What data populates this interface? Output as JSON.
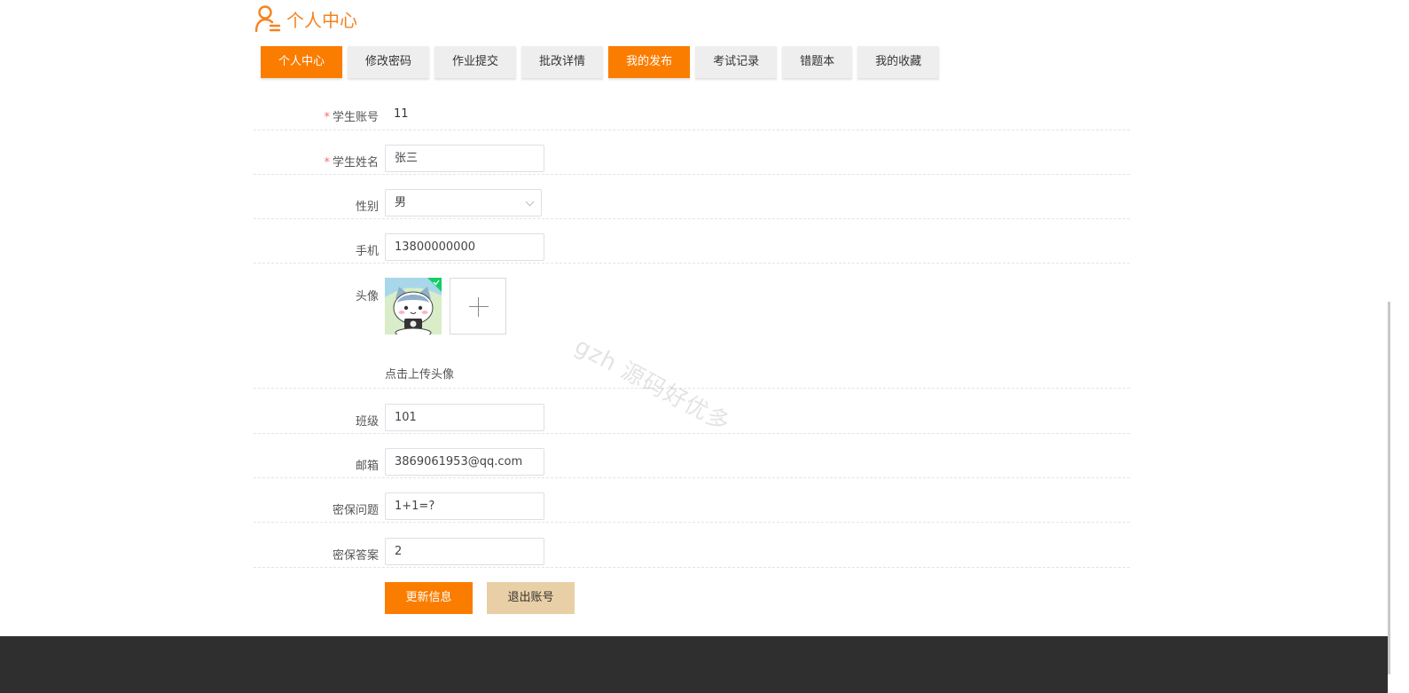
{
  "header": {
    "title": "个人中心"
  },
  "tabs": [
    {
      "label": "个人中心",
      "active": true
    },
    {
      "label": "修改密码",
      "active": false
    },
    {
      "label": "作业提交",
      "active": false
    },
    {
      "label": "批改详情",
      "active": false
    },
    {
      "label": "我的发布",
      "active": true
    },
    {
      "label": "考试记录",
      "active": false
    },
    {
      "label": "错题本",
      "active": false
    },
    {
      "label": "我的收藏",
      "active": false
    }
  ],
  "form": {
    "account": {
      "label": "学生账号",
      "value": "11",
      "required": true
    },
    "name": {
      "label": "学生姓名",
      "value": "张三",
      "required": true
    },
    "gender": {
      "label": "性别",
      "value": "男"
    },
    "phone": {
      "label": "手机",
      "value": "13800000000"
    },
    "avatar": {
      "label": "头像",
      "hint": "点击上传头像"
    },
    "class": {
      "label": "班级",
      "value": "101"
    },
    "email": {
      "label": "邮箱",
      "value": "3869061953@qq.com"
    },
    "question": {
      "label": "密保问题",
      "value": "1+1=?"
    },
    "answer": {
      "label": "密保答案",
      "value": "2"
    }
  },
  "buttons": {
    "update": "更新信息",
    "logout": "退出账号"
  },
  "watermark": "gzh 源码好优多",
  "colors": {
    "accent": "#fa7d00",
    "secondary": "#e9cfa6",
    "required": "#f56c6c",
    "footer": "#2f2f2f"
  }
}
